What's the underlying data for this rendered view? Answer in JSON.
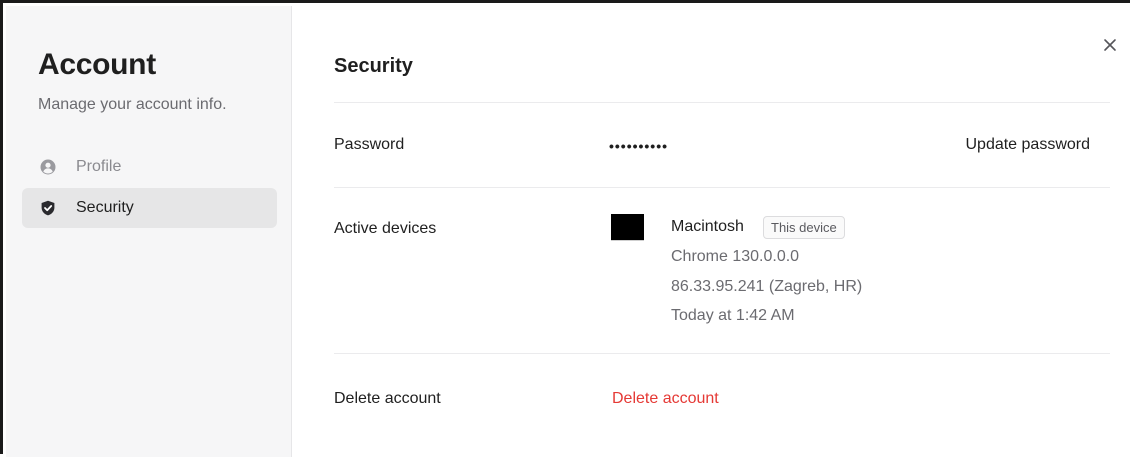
{
  "sidebar": {
    "title": "Account",
    "subtitle": "Manage your account info.",
    "items": [
      {
        "label": "Profile",
        "icon": "user-circle-icon",
        "active": false
      },
      {
        "label": "Security",
        "icon": "shield-check-icon",
        "active": true
      }
    ]
  },
  "main": {
    "title": "Security",
    "close_icon": "close-icon",
    "password": {
      "label": "Password",
      "masked_value": "••••••••••",
      "action_label": "Update password"
    },
    "devices": {
      "label": "Active devices",
      "items": [
        {
          "name": "Macintosh",
          "badge": "This device",
          "browser": "Chrome 130.0.0.0",
          "location": "86.33.95.241 (Zagreb, HR)",
          "last_active": "Today at 1:42 AM"
        }
      ]
    },
    "delete": {
      "label": "Delete account",
      "action_label": "Delete account",
      "action_color": "#e53935"
    }
  }
}
